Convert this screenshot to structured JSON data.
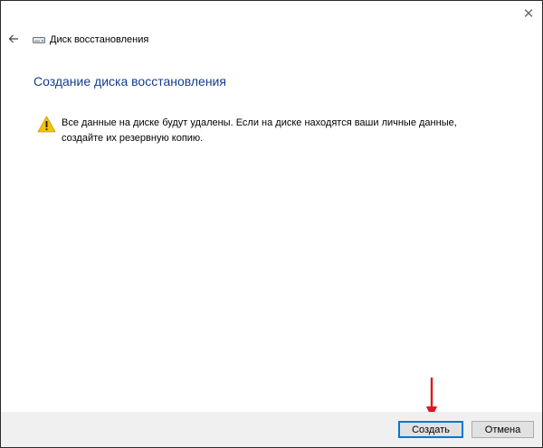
{
  "window": {
    "title": "Диск восстановления",
    "close_glyph": "✕"
  },
  "page": {
    "heading": "Создание диска восстановления",
    "warning_text": "Все данные на диске будут удалены. Если на диске находятся ваши личные данные, создайте их резервную копию."
  },
  "footer": {
    "create_label": "Создать",
    "cancel_label": "Отмена"
  },
  "colors": {
    "heading": "#133c8b",
    "accent_border": "#0078d7",
    "annotation_arrow": "#e0161e",
    "warning_fill": "#f5c400"
  },
  "icons": {
    "back": "back-arrow-icon",
    "drive": "drive-icon",
    "warning": "warning-icon",
    "close": "close-icon"
  }
}
